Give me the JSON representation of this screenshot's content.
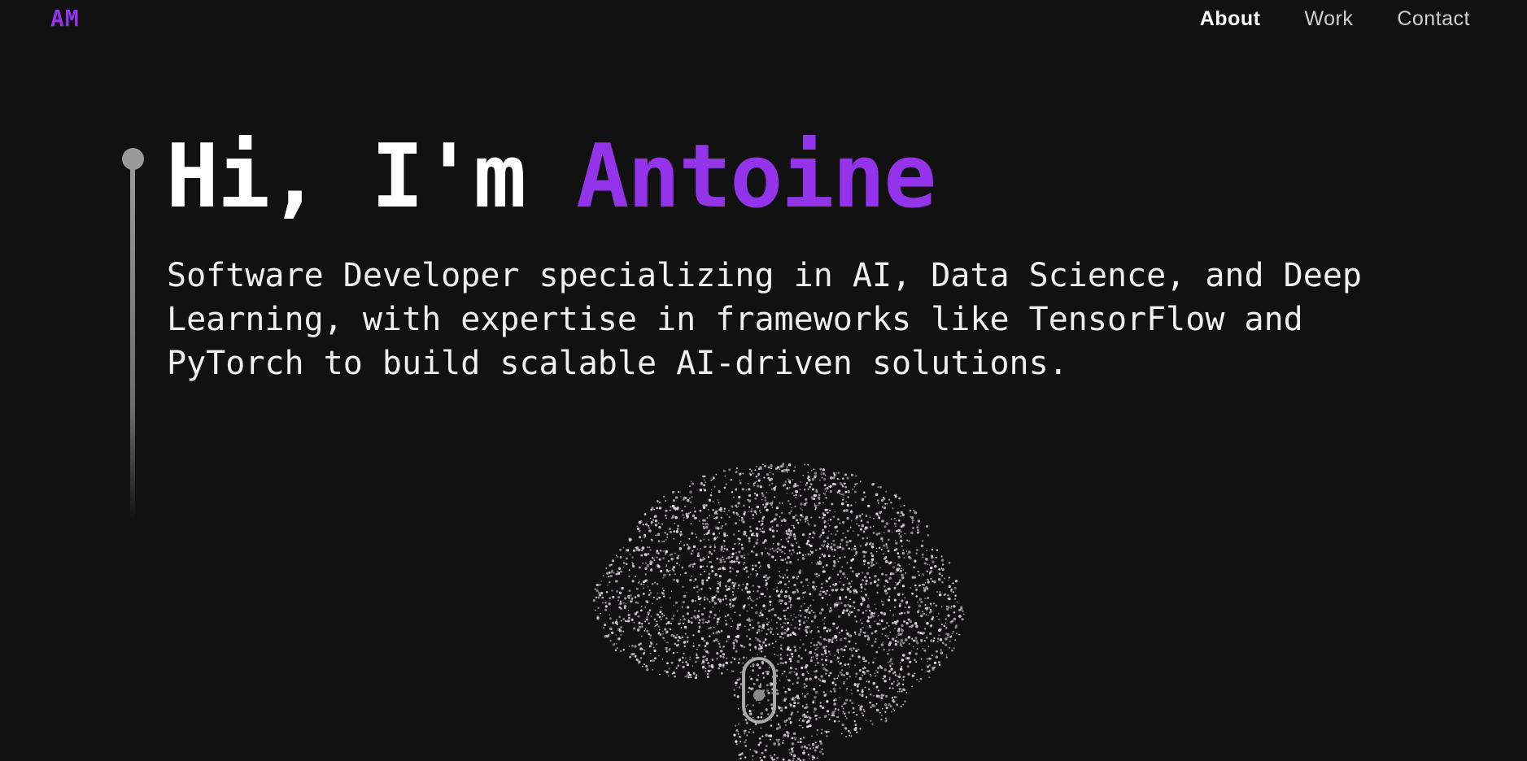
{
  "header": {
    "logo": "AM",
    "nav": [
      {
        "label": "About",
        "active": true
      },
      {
        "label": "Work",
        "active": false
      },
      {
        "label": "Contact",
        "active": false
      }
    ]
  },
  "hero": {
    "greeting": "Hi, I'm ",
    "name": "Antoine",
    "subtitle": "Software Developer specializing in AI, Data Science, and Deep Learning, with expertise in frameworks like TensorFlow and PyTorch to build scalable AI-driven solutions."
  },
  "colors": {
    "background": "#121112",
    "accent": "#9333ea",
    "text": "#ffffff",
    "particle": "#e8dcea"
  },
  "visual": {
    "brain_icon": "brain-particle-cloud",
    "scroll_icon": "mouse-scroll-icon"
  }
}
